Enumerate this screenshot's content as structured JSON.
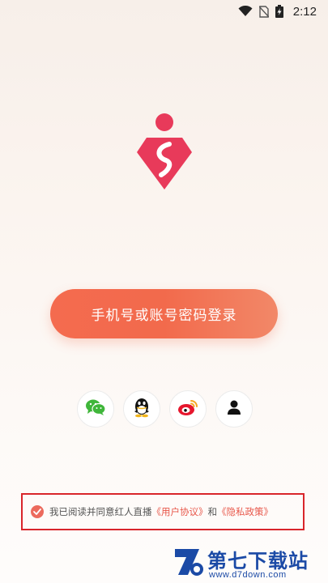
{
  "status_bar": {
    "time": "2:12",
    "icons": [
      "wifi-icon",
      "no-sim-icon",
      "battery-charging-icon"
    ]
  },
  "app": {
    "logo": "diamond-logo-icon",
    "brand_color": "#e83a5a"
  },
  "login": {
    "phone_login_label": "手机号或账号密码登录",
    "button_color": "#f26a4c"
  },
  "social_login": [
    {
      "name": "wechat",
      "icon": "wechat-icon"
    },
    {
      "name": "qq",
      "icon": "qq-icon"
    },
    {
      "name": "weibo",
      "icon": "weibo-icon"
    },
    {
      "name": "account",
      "icon": "user-icon"
    }
  ],
  "agreement": {
    "checked": true,
    "prefix": "我已阅读并同意红人直播",
    "user_agreement": "《用户协议》",
    "conjunction": "和",
    "privacy_policy": "《隐私政策》",
    "link_color": "#e8574a"
  },
  "watermark": {
    "title": "第七下载站",
    "url": "www.d7down.com"
  }
}
